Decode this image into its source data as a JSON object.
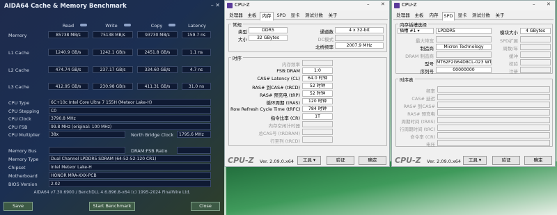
{
  "aida": {
    "title": "AIDA64 Cache & Memory Benchmark",
    "window_controls": "–  ✕",
    "columns": [
      "Read",
      "Write",
      "Copy",
      "Latency"
    ],
    "rows": [
      {
        "label": "Memory",
        "read": "85738 MB/s",
        "write": "75138 MB/s",
        "copy": "93730 MB/s",
        "latency": "159.7 ns"
      },
      {
        "label": "L1 Cache",
        "read": "1240.9 GB/s",
        "write": "1242.1 GB/s",
        "copy": "2451.8 GB/s",
        "latency": "1.1 ns"
      },
      {
        "label": "L2 Cache",
        "read": "474.74 GB/s",
        "write": "237.17 GB/s",
        "copy": "334.60 GB/s",
        "latency": "4.7 ns"
      },
      {
        "label": "L3 Cache",
        "read": "412.95 GB/s",
        "write": "230.98 GB/s",
        "copy": "411.31 GB/s",
        "latency": "31.0 ns"
      }
    ],
    "info": [
      {
        "label": "CPU Type",
        "value": "6C+10c Intel Core Ultra 7 155H  (Meteor Lake-H)"
      },
      {
        "label": "CPU Stepping",
        "value": "C0"
      },
      {
        "label": "CPU Clock",
        "value": "3790.8 MHz"
      },
      {
        "label": "CPU FSB",
        "value": "99.8 MHz  (original: 100 MHz)"
      },
      {
        "label": "CPU Multiplier",
        "value": "38x"
      },
      {
        "label": "Memory Bus",
        "value": ""
      },
      {
        "label": "Memory Type",
        "value": "Dual Channel LPDDR5 SDRAM  (64-52-52-120 CR1)"
      },
      {
        "label": "Chipset",
        "value": "Intel Meteor Lake-H"
      },
      {
        "label": "Motherboard",
        "value": "HONOR MRA-XXX-PCB"
      },
      {
        "label": "BIOS Version",
        "value": "2.02"
      }
    ],
    "nb_clock_label": "North Bridge Clock",
    "nb_clock_value": "1795.6 MHz",
    "dram_fsb_label": "DRAM:FSB Ratio",
    "footer": "AIDA64 v7.30.6900 / BenchDLL 4.6.896.8-x64  (c) 1995-2024 FinalWire Ltd.",
    "buttons": {
      "save": "Save",
      "start": "Start Benchmark",
      "close": "Close"
    }
  },
  "cpuz1": {
    "title": "CPU-Z",
    "tabs": [
      "处理器",
      "主板",
      "内存",
      "SPD",
      "显卡",
      "测试分数",
      "关于"
    ],
    "active_tab": "内存",
    "general_title": "常规",
    "type_label": "类型",
    "type_value": "DDR5",
    "size_label": "大小",
    "size_value": "32 GBytes",
    "channels_label": "通道数",
    "channels_value": "4 x 32-bit",
    "dc_label": "DC模式",
    "nb_label": "北桥频率",
    "nb_value": "2007.9 MHz",
    "timing_title": "时序",
    "timings": [
      {
        "label": "内存频率",
        "value": "",
        "dim": true
      },
      {
        "label": "FSB:DRAM",
        "value": "1:0",
        "dim": false
      },
      {
        "label": "CAS# Latency (CL)",
        "value": "64.0 时钟",
        "dim": false
      },
      {
        "label": "RAS# 到CAS# (tRCD)",
        "value": "52 时钟",
        "dim": false
      },
      {
        "label": "RAS# 预充电 (tRP)",
        "value": "52 时钟",
        "dim": false
      },
      {
        "label": "循环周期 (tRAS)",
        "value": "120 时钟",
        "dim": false
      },
      {
        "label": "Row Refresh Cycle Time (tRFC)",
        "value": "784 时钟",
        "dim": false
      },
      {
        "label": "指令比率 (CR)",
        "value": "1T",
        "dim": false
      },
      {
        "label": "内存空闲计时器",
        "value": "",
        "dim": true
      },
      {
        "label": "总CAS号 (tRDRAM)",
        "value": "",
        "dim": true
      },
      {
        "label": "行至列 (tRCD)",
        "value": "",
        "dim": true
      }
    ],
    "logo": "CPU-Z",
    "version": "Ver. 2.09.0.x64",
    "tools": "工具",
    "validate": "验证",
    "ok": "确定"
  },
  "cpuz2": {
    "title": "CPU-Z",
    "tabs": [
      "处理器",
      "主板",
      "内存",
      "SPD",
      "显卡",
      "测试分数",
      "关于"
    ],
    "active_tab": "SPD",
    "slot_group_title": "内存插槽选择",
    "slot_value": "插槽 #1",
    "slot_type": "LPDDR5",
    "module_size_label": "模块大小",
    "module_size_value": "4 GBytes",
    "left_fields": [
      {
        "label": "最大带宽",
        "value": "",
        "dim": true
      },
      {
        "label": "制造商",
        "value": "Micron Technology",
        "dim": false
      },
      {
        "label": "DRAM 制造商",
        "value": "",
        "dim": true
      },
      {
        "label": "型号",
        "value": "MT62F2G64D8CL-023 WT",
        "dim": false
      },
      {
        "label": "序列号",
        "value": "00000000",
        "dim": false
      }
    ],
    "right_labels": [
      "SPD扩展",
      "周数/年",
      "缓冲",
      "校验",
      "注册"
    ],
    "timing_title": "时序表",
    "timing_rows": [
      "频率",
      "CAS# 延迟",
      "RAS# 到CAS#",
      "RAS# 预充电",
      "周期时间 (tRAS)",
      "行周期时间 (tRC)",
      "命令率 (CR)",
      "电压"
    ],
    "logo": "CPU-Z",
    "version": "Ver. 2.09.0.x64",
    "tools": "工具",
    "validate": "验证",
    "ok": "确定"
  },
  "colors": {
    "aida_bg": "#1e2b4d",
    "cpuz_bg": "#f0f0f0",
    "cpuz_logo": "#7a7a7a",
    "desktop_green": "#3f9a5b"
  }
}
